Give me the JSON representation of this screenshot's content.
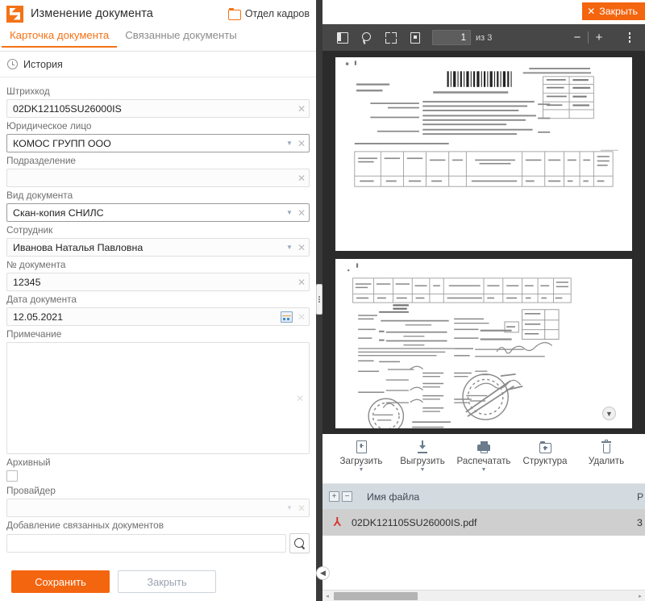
{
  "window": {
    "title": "Изменение документа",
    "department": "Отдел кадров",
    "logo_icon": "app-logo-icon",
    "folder_icon": "folder-icon"
  },
  "tabs": [
    {
      "label": "Карточка документа",
      "active": true
    },
    {
      "label": "Связанные документы",
      "active": false
    }
  ],
  "history": {
    "label": "История",
    "icon": "clock-icon"
  },
  "form": {
    "fields": [
      {
        "label": "Штрихкод",
        "value": "02DK121105SU26000IS",
        "type": "text",
        "bordered": false,
        "has_caret": false,
        "has_clear": true
      },
      {
        "label": "Юридическое лицо",
        "value": "КОМОС ГРУПП ООО",
        "type": "select",
        "bordered": true,
        "has_caret": true,
        "has_clear": true
      },
      {
        "label": "Подразделение",
        "value": "",
        "type": "text",
        "bordered": false,
        "has_caret": false,
        "has_clear": true
      },
      {
        "label": "Вид документа",
        "value": "Скан-копия СНИЛС",
        "type": "select",
        "bordered": true,
        "has_caret": true,
        "has_clear": true
      },
      {
        "label": "Сотрудник",
        "value": "Иванова Наталья Павловна",
        "type": "select",
        "bordered": false,
        "has_caret": true,
        "has_clear": true
      },
      {
        "label": "№ документа",
        "value": "12345",
        "type": "text",
        "bordered": false,
        "has_caret": false,
        "has_clear": true
      },
      {
        "label": "Дата документа",
        "value": "12.05.2021",
        "type": "date",
        "bordered": false,
        "has_caret": false,
        "has_clear": true
      }
    ],
    "note": {
      "label": "Примечание",
      "value": ""
    },
    "archive": {
      "label": "Архивный",
      "checked": false
    },
    "provider": {
      "label": "Провайдер",
      "value": ""
    },
    "related": {
      "label": "Добавление связанных документов",
      "value": "",
      "search_icon": "search-icon"
    },
    "buttons": {
      "save": "Сохранить",
      "close": "Закрыть"
    }
  },
  "viewer": {
    "close_button": "Закрыть",
    "toolbar": {
      "icons": [
        "sidebar-toggle-icon",
        "search-icon",
        "fit-page-icon",
        "download-icon"
      ],
      "page_current": "1",
      "page_of_label": "из 3",
      "zoom_out": "−",
      "zoom_in": "+",
      "menu_icon": "kebab-menu-icon"
    },
    "scroll_down_icon": "chevron-down-icon"
  },
  "actions": [
    {
      "label": "Загрузить",
      "icon": "upload-doc-icon",
      "has_caret": true
    },
    {
      "label": "Выгрузить",
      "icon": "download-icon",
      "has_caret": true
    },
    {
      "label": "Распечатать",
      "icon": "printer-icon",
      "has_caret": true
    },
    {
      "label": "Структура",
      "icon": "add-folder-icon",
      "has_caret": false
    },
    {
      "label": "Удалить",
      "icon": "trash-icon",
      "has_caret": false
    }
  ],
  "file_table": {
    "expand_icon": "+",
    "collapse_icon": "−",
    "columns": [
      "Имя файла",
      "Р"
    ],
    "rows": [
      {
        "name": "02DK121105SU26000IS.pdf",
        "icon": "pdf-file-icon",
        "size": "3"
      }
    ]
  },
  "bottom": {
    "collapse_icon": "chevron-left-icon",
    "scroll_left_icon": "◂",
    "scroll_right_icon": "▸"
  },
  "colors": {
    "accent": "#f4650f",
    "toolbar_bg": "#474747",
    "viewer_bg": "#2b2b2b",
    "table_header": "#d3dae0"
  }
}
